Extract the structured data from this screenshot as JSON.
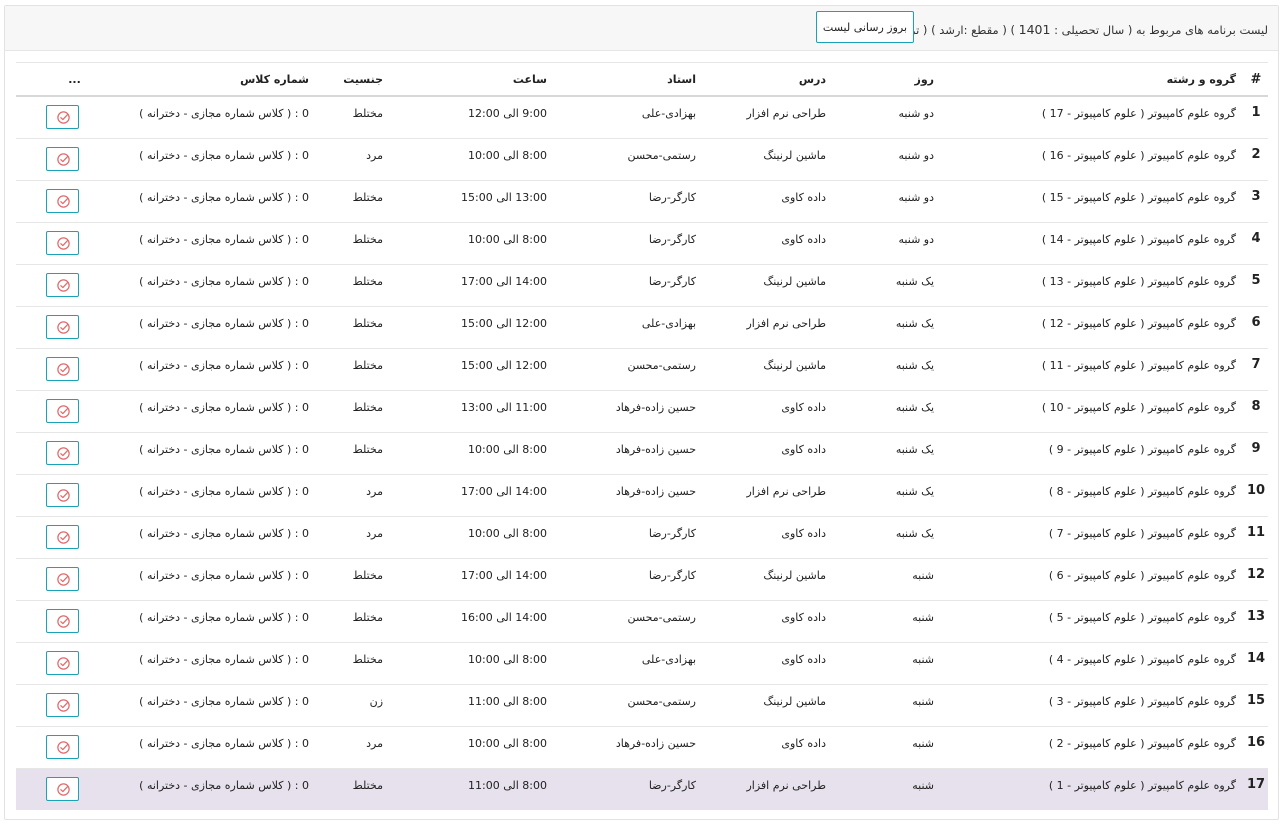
{
  "header": {
    "title_prefix": "لیست برنامه های مربوط به ( سال تحصیلی :",
    "year": "1401",
    "title_suffix": ") ( مقطع :ارشد ) ( ترم :مهر )",
    "refresh_label": "بروز رسانی لیست"
  },
  "table": {
    "columns": {
      "num": "#",
      "group": "گروه و رشته",
      "day": "روز",
      "lesson": "درس",
      "professor": "استاد",
      "time": "ساعت",
      "gender": "جنسیت",
      "class": "شماره کلاس",
      "actions": "..."
    },
    "rows": [
      {
        "num": "1",
        "group": "گروه علوم کامپیوتر ( علوم کامپیوتر - 17 )",
        "day": "دو شنبه",
        "lesson": "طراحی نرم افزار",
        "professor": "بهزادی-علی",
        "time": "9:00 الی 12:00",
        "gender": "مختلط",
        "class": "0 : ( کلاس شماره مجازی - دخترانه )"
      },
      {
        "num": "2",
        "group": "گروه علوم کامپیوتر ( علوم کامپیوتر - 16 )",
        "day": "دو شنبه",
        "lesson": "ماشین لرنینگ",
        "professor": "رستمی-محسن",
        "time": "8:00 الی 10:00",
        "gender": "مرد",
        "class": "0 : ( کلاس شماره مجازی - دخترانه )"
      },
      {
        "num": "3",
        "group": "گروه علوم کامپیوتر ( علوم کامپیوتر - 15 )",
        "day": "دو شنبه",
        "lesson": "داده کاوی",
        "professor": "کارگر-رضا",
        "time": "13:00 الی 15:00",
        "gender": "مختلط",
        "class": "0 : ( کلاس شماره مجازی - دخترانه )"
      },
      {
        "num": "4",
        "group": "گروه علوم کامپیوتر ( علوم کامپیوتر - 14 )",
        "day": "دو شنبه",
        "lesson": "داده کاوی",
        "professor": "کارگر-رضا",
        "time": "8:00 الی 10:00",
        "gender": "مختلط",
        "class": "0 : ( کلاس شماره مجازی - دخترانه )"
      },
      {
        "num": "5",
        "group": "گروه علوم کامپیوتر ( علوم کامپیوتر - 13 )",
        "day": "یک شنبه",
        "lesson": "ماشین لرنینگ",
        "professor": "کارگر-رضا",
        "time": "14:00 الی 17:00",
        "gender": "مختلط",
        "class": "0 : ( کلاس شماره مجازی - دخترانه )"
      },
      {
        "num": "6",
        "group": "گروه علوم کامپیوتر ( علوم کامپیوتر - 12 )",
        "day": "یک شنبه",
        "lesson": "طراحی نرم افزار",
        "professor": "بهزادی-علی",
        "time": "12:00 الی 15:00",
        "gender": "مختلط",
        "class": "0 : ( کلاس شماره مجازی - دخترانه )"
      },
      {
        "num": "7",
        "group": "گروه علوم کامپیوتر ( علوم کامپیوتر - 11 )",
        "day": "یک شنبه",
        "lesson": "ماشین لرنینگ",
        "professor": "رستمی-محسن",
        "time": "12:00 الی 15:00",
        "gender": "مختلط",
        "class": "0 : ( کلاس شماره مجازی - دخترانه )"
      },
      {
        "num": "8",
        "group": "گروه علوم کامپیوتر ( علوم کامپیوتر - 10 )",
        "day": "یک شنبه",
        "lesson": "داده کاوی",
        "professor": "حسین زاده-فرهاد",
        "time": "11:00 الی 13:00",
        "gender": "مختلط",
        "class": "0 : ( کلاس شماره مجازی - دخترانه )"
      },
      {
        "num": "9",
        "group": "گروه علوم کامپیوتر ( علوم کامپیوتر - 9 )",
        "day": "یک شنبه",
        "lesson": "داده کاوی",
        "professor": "حسین زاده-فرهاد",
        "time": "8:00 الی 10:00",
        "gender": "مختلط",
        "class": "0 : ( کلاس شماره مجازی - دخترانه )"
      },
      {
        "num": "10",
        "group": "گروه علوم کامپیوتر ( علوم کامپیوتر - 8 )",
        "day": "یک شنبه",
        "lesson": "طراحی نرم افزار",
        "professor": "حسین زاده-فرهاد",
        "time": "14:00 الی 17:00",
        "gender": "مرد",
        "class": "0 : ( کلاس شماره مجازی - دخترانه )"
      },
      {
        "num": "11",
        "group": "گروه علوم کامپیوتر ( علوم کامپیوتر - 7 )",
        "day": "یک شنبه",
        "lesson": "داده کاوی",
        "professor": "کارگر-رضا",
        "time": "8:00 الی 10:00",
        "gender": "مرد",
        "class": "0 : ( کلاس شماره مجازی - دخترانه )"
      },
      {
        "num": "12",
        "group": "گروه علوم کامپیوتر ( علوم کامپیوتر - 6 )",
        "day": "شنبه",
        "lesson": "ماشین لرنینگ",
        "professor": "کارگر-رضا",
        "time": "14:00 الی 17:00",
        "gender": "مختلط",
        "class": "0 : ( کلاس شماره مجازی - دخترانه )"
      },
      {
        "num": "13",
        "group": "گروه علوم کامپیوتر ( علوم کامپیوتر - 5 )",
        "day": "شنبه",
        "lesson": "داده کاوی",
        "professor": "رستمی-محسن",
        "time": "14:00 الی 16:00",
        "gender": "مختلط",
        "class": "0 : ( کلاس شماره مجازی - دخترانه )"
      },
      {
        "num": "14",
        "group": "گروه علوم کامپیوتر ( علوم کامپیوتر - 4 )",
        "day": "شنبه",
        "lesson": "داده کاوی",
        "professor": "بهزادی-علی",
        "time": "8:00 الی 10:00",
        "gender": "مختلط",
        "class": "0 : ( کلاس شماره مجازی - دخترانه )"
      },
      {
        "num": "15",
        "group": "گروه علوم کامپیوتر ( علوم کامپیوتر - 3 )",
        "day": "شنبه",
        "lesson": "ماشین لرنینگ",
        "professor": "رستمی-محسن",
        "time": "8:00 الی 11:00",
        "gender": "زن",
        "class": "0 : ( کلاس شماره مجازی - دخترانه )"
      },
      {
        "num": "16",
        "group": "گروه علوم کامپیوتر ( علوم کامپیوتر - 2 )",
        "day": "شنبه",
        "lesson": "داده کاوی",
        "professor": "حسین زاده-فرهاد",
        "time": "8:00 الی 10:00",
        "gender": "مرد",
        "class": "0 : ( کلاس شماره مجازی - دخترانه )"
      },
      {
        "num": "17",
        "group": "گروه علوم کامپیوتر ( علوم کامپیوتر - 1 )",
        "day": "شنبه",
        "lesson": "طراحی نرم افزار",
        "professor": "کارگر-رضا",
        "time": "8:00 الی 11:00",
        "gender": "مختلط",
        "class": "0 : ( کلاس شماره مجازی - دخترانه )",
        "selected": true
      }
    ]
  },
  "colors": {
    "accent": "#1aa3b8",
    "icon": "#e06a6a",
    "selected_row": "#e6e1ec",
    "header_bg": "#f7f7f7"
  },
  "icons": {
    "row_action": "check-circle-icon"
  }
}
